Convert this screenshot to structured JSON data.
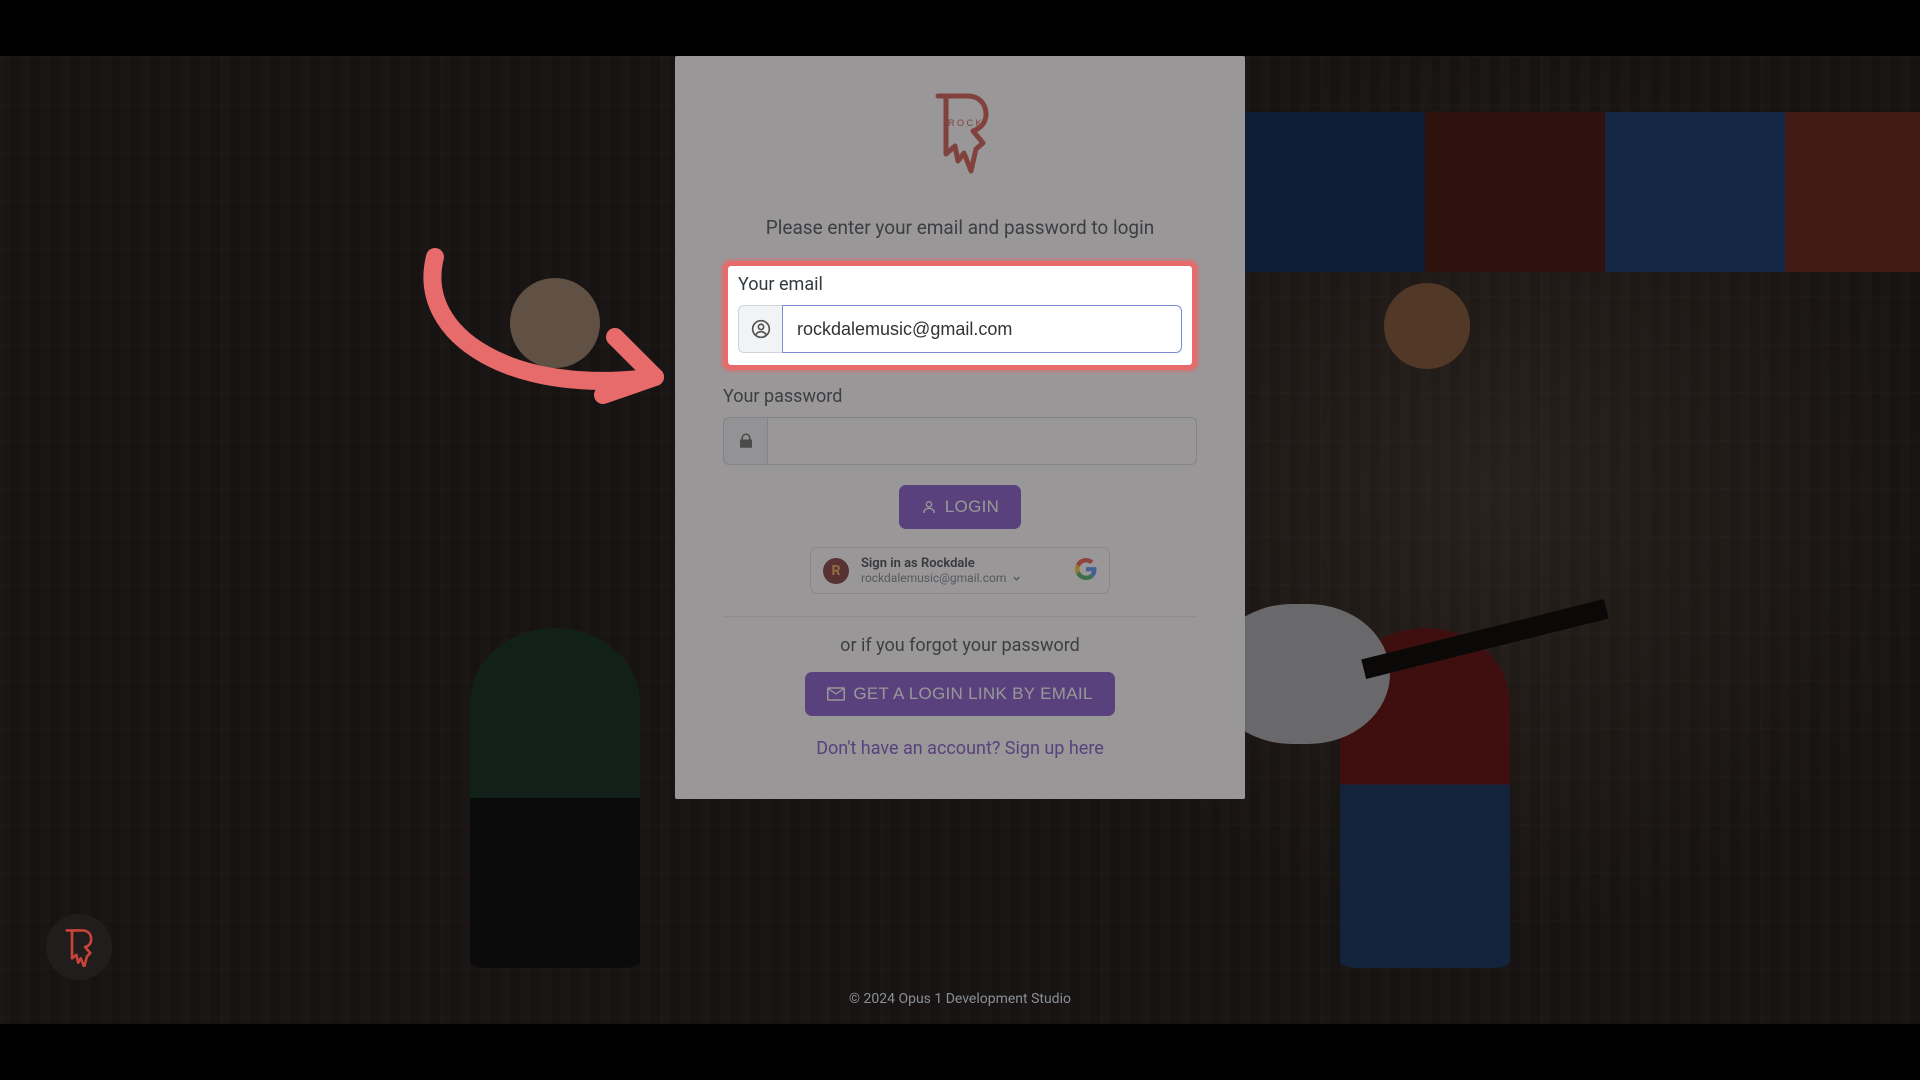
{
  "brand": {
    "letter": "R"
  },
  "card": {
    "instruction": "Please enter your email and password to login",
    "email_label": "Your email",
    "email_value": "rockdalemusic@gmail.com",
    "password_label": "Your password",
    "password_value": "",
    "login_label": "LOGIN",
    "google": {
      "title": "Sign in as Rockdale",
      "subtitle": "rockdalemusic@gmail.com"
    },
    "forgot_text": "or if you forgot your password",
    "magic_link_label": "GET A LOGIN LINK BY EMAIL",
    "signup_text": "Don't have an account? Sign up here"
  },
  "footer": "© 2024 Opus 1 Development Studio",
  "icons": {
    "user": "user-circle-icon",
    "lock": "lock-icon",
    "person": "person-icon",
    "mail": "mail-icon",
    "chevron": "chevron-down-icon",
    "google": "google-g-icon"
  },
  "colors": {
    "accent_purple": "#6f42c1",
    "highlight_red": "#e86b6b",
    "logo_red": "#c94438"
  }
}
